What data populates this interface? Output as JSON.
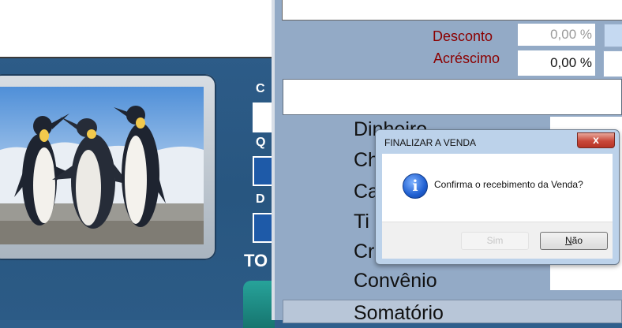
{
  "left": {
    "labels": {
      "c": "C",
      "q": "Q",
      "d": "D",
      "tot": "TO"
    }
  },
  "right": {
    "desconto_label": "Desconto",
    "desconto_value": "0,00 %",
    "acrescimo_label": "Acréscimo",
    "acrescimo_value": "0,00 %",
    "payment_methods": [
      "Dinheiro",
      "Ch",
      "Ca",
      "Ti",
      "Cr",
      "Convênio"
    ],
    "somatorio_label": "Somatório"
  },
  "dialog": {
    "title": "FINALIZAR A VENDA",
    "close_glyph": "x",
    "icon": "info-icon",
    "message": "Confirma o recebimento da Venda?",
    "yes_label": "Sim",
    "no_label_first": "N",
    "no_label_rest": "ão"
  },
  "colors": {
    "left_bg": "#2f5e8b",
    "right_bg": "#93aac6",
    "label_red": "#8b0000",
    "dialog_frame": "#bcd2ea"
  }
}
